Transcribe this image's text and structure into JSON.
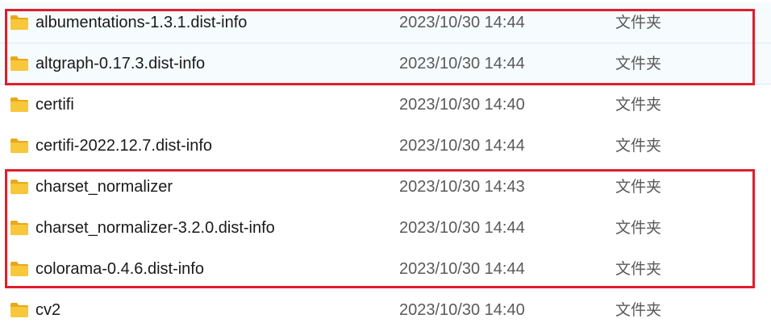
{
  "file_list": {
    "rows": [
      {
        "name": "albumentations-1.3.1.dist-info",
        "modified": "2023/10/30 14:44",
        "type": "文件夹",
        "icon": "folder-icon"
      },
      {
        "name": "altgraph-0.17.3.dist-info",
        "modified": "2023/10/30 14:44",
        "type": "文件夹",
        "icon": "folder-icon"
      },
      {
        "name": "certifi",
        "modified": "2023/10/30 14:40",
        "type": "文件夹",
        "icon": "folder-icon"
      },
      {
        "name": "certifi-2022.12.7.dist-info",
        "modified": "2023/10/30 14:44",
        "type": "文件夹",
        "icon": "folder-icon"
      },
      {
        "name": "charset_normalizer",
        "modified": "2023/10/30 14:43",
        "type": "文件夹",
        "icon": "folder-icon"
      },
      {
        "name": "charset_normalizer-3.2.0.dist-info",
        "modified": "2023/10/30 14:44",
        "type": "文件夹",
        "icon": "folder-icon"
      },
      {
        "name": "colorama-0.4.6.dist-info",
        "modified": "2023/10/30 14:44",
        "type": "文件夹",
        "icon": "folder-icon"
      },
      {
        "name": "cv2",
        "modified": "2023/10/30 14:40",
        "type": "文件夹",
        "icon": "folder-icon"
      }
    ]
  },
  "colors": {
    "highlight_border": "#e11d2b",
    "folder_fill": "#f8c73a",
    "folder_back": "#e8a81a",
    "selection_background": "#f6fbfd"
  }
}
